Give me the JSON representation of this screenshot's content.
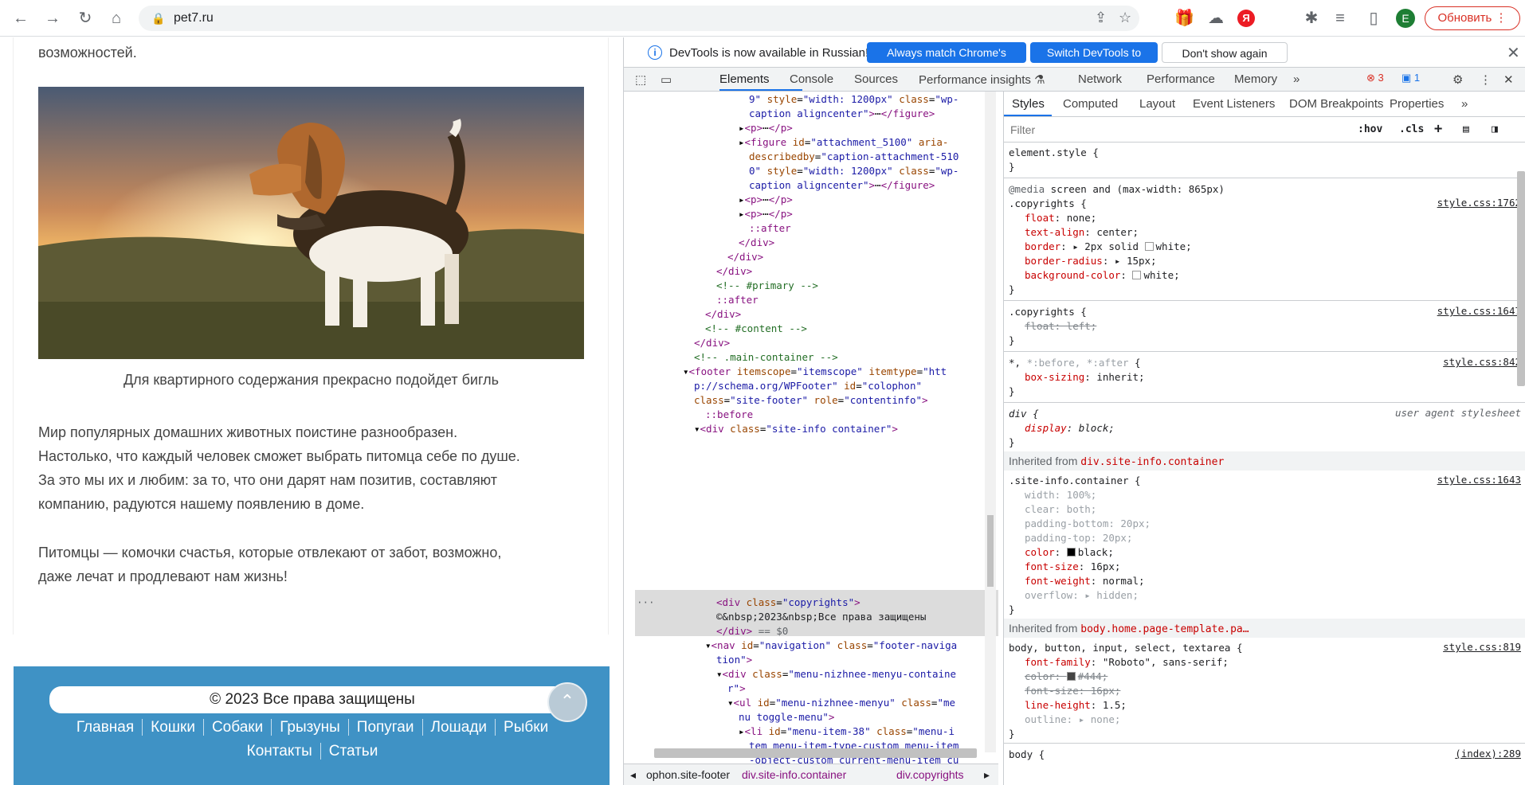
{
  "browser": {
    "url": "pet7.ru",
    "update_label": "Обновить",
    "profile_initial": "E",
    "yandex_label": "Я"
  },
  "page": {
    "top_text": "возможностей.",
    "caption": "Для квартирного содержания прекрасно подойдет бигль",
    "para1": [
      "Мир популярных домашних животных поистине разнообразен.",
      "Настолько, что каждый человек сможет выбрать питомца себе по душе.",
      "За это мы их и любим: за то, что они дарят нам позитив, составляют",
      "компанию, радуются нашему появлению в доме."
    ],
    "para2": [
      "Питомцы — комочки счастья, которые отвлекают от забот, возможно,",
      "даже лечат и продлевают нам жизнь!"
    ],
    "copyright": "© 2023 Все права защищены",
    "menu_row1": [
      "Главная",
      "Кошки",
      "Собаки",
      "Грызуны",
      "Попугаи",
      "Лошади",
      "Рыбки"
    ],
    "menu_row2": [
      "Контакты",
      "Статьи"
    ]
  },
  "devtools": {
    "infobar": {
      "message": "DevTools is now available in Russian!",
      "btn_match": "Always match Chrome's language",
      "btn_switch": "Switch DevTools to Russian",
      "btn_dismiss": "Don't show again"
    },
    "tabs": [
      "Elements",
      "Console",
      "Sources",
      "Performance insights ⚗",
      "Network",
      "Performance",
      "Memory",
      "»"
    ],
    "errors": "3",
    "messages": "1",
    "styles_tabs": [
      "Styles",
      "Computed",
      "Layout",
      "Event Listeners",
      "DOM Breakpoints",
      "Properties",
      "»"
    ],
    "filter_placeholder": "Filter",
    "hov": ":hov",
    "cls": ".cls",
    "breadcrumbs": [
      "ophon.site-footer",
      "div.site-info.container",
      "div.copyrights"
    ]
  },
  "colors": {
    "footer_bg": "#3f92c5",
    "devtools_accent": "#1a73e8",
    "update_red": "#d93025"
  }
}
